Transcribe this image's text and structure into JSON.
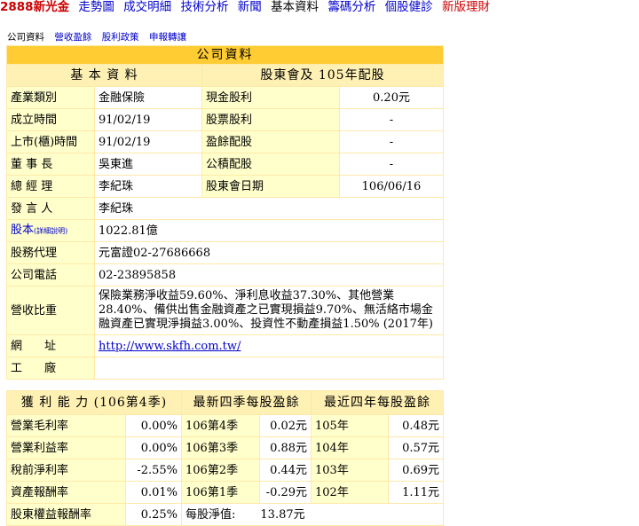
{
  "topnav": {
    "stock": "2888新光金",
    "items": [
      "走勢圖",
      "成交明細",
      "技術分析",
      "新聞",
      "基本資料",
      "籌碼分析",
      "個股健診",
      "新版理財"
    ]
  },
  "subnav": {
    "current": "公司資料",
    "links": [
      "營收盈餘",
      "股利政策",
      "申報轉讓"
    ]
  },
  "table": {
    "title": "公司資料",
    "left_header": "基 本 資 料",
    "right_header": "股東會及 105年配股",
    "rows": [
      {
        "label": "產業類別",
        "value": "金融保險",
        "rlabel": "現金股利",
        "rvalue": "0.20元"
      },
      {
        "label": "成立時間",
        "value": "91/02/19",
        "rlabel": "股票股利",
        "rvalue": "-"
      },
      {
        "label": "上市(櫃)時間",
        "value": "91/02/19",
        "rlabel": "盈餘配股",
        "rvalue": "-"
      },
      {
        "label": "董 事 長",
        "value": "吳東進",
        "rlabel": "公積配股",
        "rvalue": "-"
      },
      {
        "label": "總 經 理",
        "value": "李紀珠",
        "rlabel": "股東會日期",
        "rvalue": "106/06/16"
      }
    ],
    "spokesperson_label": "發 言 人",
    "spokesperson": "李紀珠",
    "capital_label": "股本",
    "capital_note": "(詳細說明)",
    "capital": "1022.81億",
    "agent_label": "股務代理",
    "agent": "元富證02-27686668",
    "phone_label": "公司電話",
    "phone": "02-23895858",
    "revenue_label": "營收比重",
    "revenue": "保險業務淨收益59.60%、淨利息收益37.30%、其他營業28.40%、備供出售金融資產之已實現損益9.70%、無活絡市場金融資產已實現淨損益3.00%、投資性不動產損益1.50% (2017年)",
    "website_label": "網　址",
    "website": "http://www.skfh.com.tw/",
    "factory_label": "工　廠",
    "factory": ""
  },
  "profit": {
    "header_left": "獲 利 能 力 (106第4季)",
    "header_mid": "最新四季每股盈餘",
    "header_right": "最近四年每股盈餘",
    "rows": [
      {
        "label": "營業毛利率",
        "value": "0.00%",
        "q": "106第4季",
        "eps": "0.02元",
        "year": "105年",
        "yeps": "0.48元"
      },
      {
        "label": "營業利益率",
        "value": "0.00%",
        "q": "106第3季",
        "eps": "0.88元",
        "year": "104年",
        "yeps": "0.57元"
      },
      {
        "label": "稅前淨利率",
        "value": "-2.55%",
        "q": "106第2季",
        "eps": "0.44元",
        "year": "103年",
        "yeps": "0.69元"
      },
      {
        "label": "資產報酬率",
        "value": "0.01%",
        "q": "106第1季",
        "eps": "-0.29元",
        "year": "102年",
        "yeps": "1.11元"
      }
    ],
    "last": {
      "label": "股東權益報酬率",
      "value": "0.25%",
      "bvps_label": "每股淨值:",
      "bvps": "13.87元"
    }
  }
}
